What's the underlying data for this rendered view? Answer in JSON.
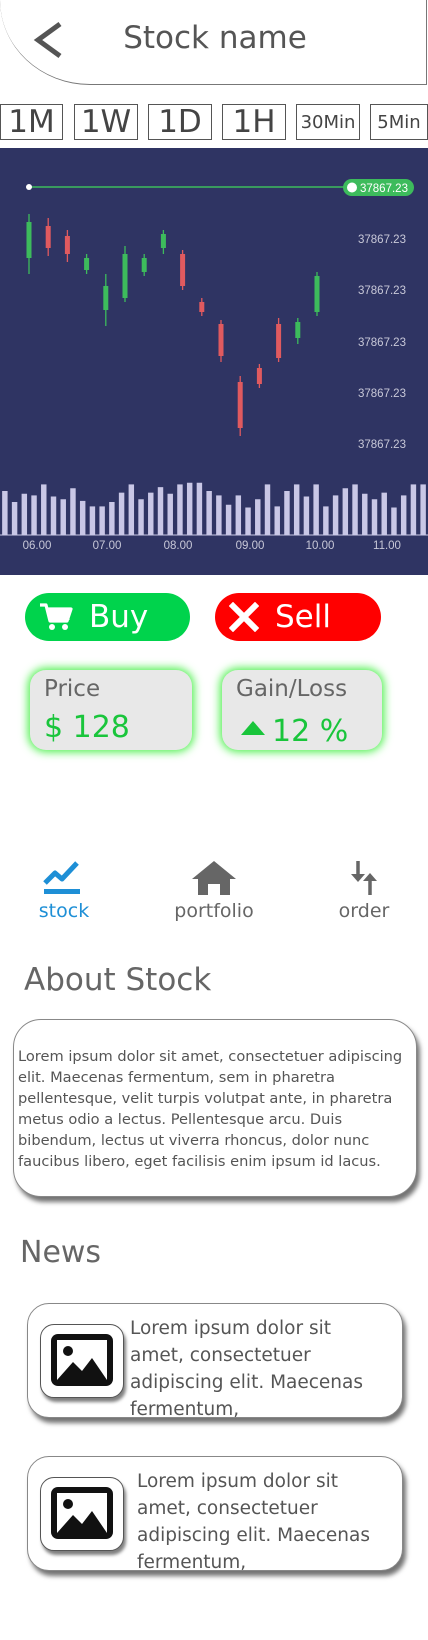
{
  "header": {
    "title": "Stock name"
  },
  "timeframes": [
    "1M",
    "1W",
    "1D",
    "1H",
    "30Min",
    "5Min"
  ],
  "chart_data": {
    "type": "candlestick",
    "current_price_label": "37867.23",
    "y_tick_labels": [
      "37867.23",
      "37867.23",
      "37867.23",
      "37867.23",
      "37867.23"
    ],
    "x_tick_labels": [
      "06.00",
      "07.00",
      "08.00",
      "09.00",
      "10.00",
      "11.00"
    ],
    "colors": {
      "background": "#2f3463",
      "up": "#3dbb5c",
      "down": "#e05a5f",
      "volume": "#c9c7e6",
      "price_line": "#3dbb5c"
    },
    "candles": [
      {
        "dir": "up",
        "open": 0.6,
        "close": 0.78,
        "low": 0.52,
        "high": 0.82
      },
      {
        "dir": "down",
        "open": 0.76,
        "close": 0.65,
        "low": 0.61,
        "high": 0.8
      },
      {
        "dir": "down",
        "open": 0.71,
        "close": 0.62,
        "low": 0.58,
        "high": 0.74
      },
      {
        "dir": "up",
        "open": 0.54,
        "close": 0.6,
        "low": 0.52,
        "high": 0.62
      },
      {
        "dir": "up",
        "open": 0.34,
        "close": 0.46,
        "low": 0.26,
        "high": 0.52
      },
      {
        "dir": "up",
        "open": 0.4,
        "close": 0.62,
        "low": 0.38,
        "high": 0.66
      },
      {
        "dir": "up",
        "open": 0.53,
        "close": 0.6,
        "low": 0.51,
        "high": 0.62
      },
      {
        "dir": "up",
        "open": 0.65,
        "close": 0.72,
        "low": 0.62,
        "high": 0.74
      },
      {
        "dir": "down",
        "open": 0.62,
        "close": 0.46,
        "low": 0.44,
        "high": 0.64
      },
      {
        "dir": "down",
        "open": 0.38,
        "close": 0.33,
        "low": 0.31,
        "high": 0.4
      },
      {
        "dir": "down",
        "open": 0.27,
        "close": 0.11,
        "low": 0.08,
        "high": 0.29
      },
      {
        "dir": "down",
        "open": -0.02,
        "close": -0.25,
        "low": -0.29,
        "high": 0.01
      },
      {
        "dir": "down",
        "open": 0.05,
        "close": -0.03,
        "low": -0.05,
        "high": 0.07
      },
      {
        "dir": "down",
        "open": 0.27,
        "close": 0.1,
        "low": 0.08,
        "high": 0.3
      },
      {
        "dir": "up",
        "open": 0.2,
        "close": 0.28,
        "low": 0.17,
        "high": 0.3
      },
      {
        "dir": "up",
        "open": 0.33,
        "close": 0.51,
        "low": 0.31,
        "high": 0.53
      }
    ],
    "volume": [
      0.8,
      0.6,
      0.75,
      0.72,
      0.92,
      0.7,
      0.65,
      0.85,
      0.62,
      0.52,
      0.52,
      0.6,
      0.77,
      0.92,
      0.65,
      0.77,
      0.87,
      0.75,
      0.92,
      0.95,
      0.95,
      0.8,
      0.72,
      0.55,
      0.72,
      0.5,
      0.65,
      0.92,
      0.52,
      0.8,
      0.92,
      0.7,
      0.92,
      0.52,
      0.72,
      0.85,
      0.92,
      0.75,
      0.65,
      0.77,
      0.5,
      0.72,
      0.92,
      0.92
    ]
  },
  "trade": {
    "buy_label": "Buy",
    "sell_label": "Sell"
  },
  "stats": {
    "price_label": "Price",
    "price_value": "$ 128",
    "gain_label": "Gain/Loss",
    "gain_value": "12 %",
    "gain_direction": "up"
  },
  "nav": {
    "stock": "stock",
    "portfolio": "portfolio",
    "order": "order",
    "active": "stock"
  },
  "about": {
    "title": "About Stock",
    "text": "Lorem ipsum dolor sit amet, consectetuer adipiscing elit. Maecenas fermentum, sem in pharetra pellentesque, velit turpis volutpat ante, in pharetra metus odio a lectus. Pellentesque arcu. Duis bibendum, lectus ut viverra rhoncus, dolor nunc faucibus libero, eget facilisis enim ipsum id lacus."
  },
  "news": {
    "title": "News",
    "items": [
      {
        "text": "Lorem ipsum dolor sit amet, consectetuer adipiscing elit. Maecenas fermentum,"
      },
      {
        "text": "Lorem ipsum dolor sit amet, consectetuer adipiscing elit. Maecenas fermentum,"
      }
    ]
  },
  "icons": {
    "back": "chevron-left-icon",
    "buy": "cart-icon",
    "sell": "close-icon",
    "gain": "triangle-up-icon",
    "stock": "trending-up-icon",
    "portfolio": "home-icon",
    "order": "swap-vertical-icon",
    "news": "image-icon"
  }
}
